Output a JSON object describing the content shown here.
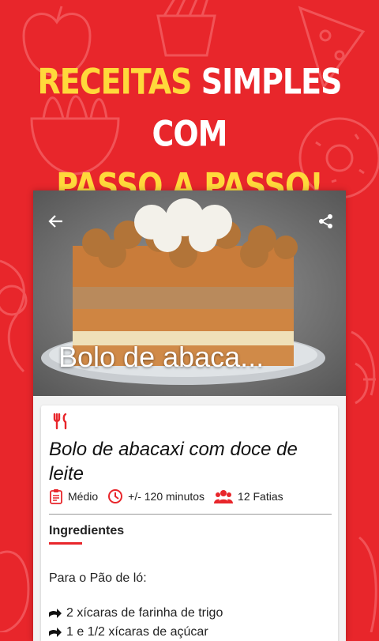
{
  "headline": {
    "line1_yellow": "RECEITAS",
    "line1_white": "SIMPLES COM",
    "line2_yellow": "PASSO A PASSO!"
  },
  "colors": {
    "background": "#e8262b",
    "accent_yellow": "#ffd93b",
    "accent_red": "#e8262b"
  },
  "toolbar": {
    "back_icon": "arrow-left-icon",
    "share_icon": "share-icon"
  },
  "hero": {
    "title": "Bolo de abaca..."
  },
  "recipe": {
    "category_icon": "utensils-icon",
    "title": "Bolo de abacaxi com doce de leite",
    "difficulty_icon": "clipboard-icon",
    "difficulty": "Médio",
    "time_icon": "clock-icon",
    "time": "+/- 120 minutos",
    "servings_icon": "people-icon",
    "servings": "12 Fatias"
  },
  "ingredients": {
    "heading": "Ingredientes",
    "group_title": "Para o Pão de ló:",
    "items": [
      "2 xícaras de farinha de trigo",
      "1 e 1/2 xícaras de açúcar"
    ]
  }
}
